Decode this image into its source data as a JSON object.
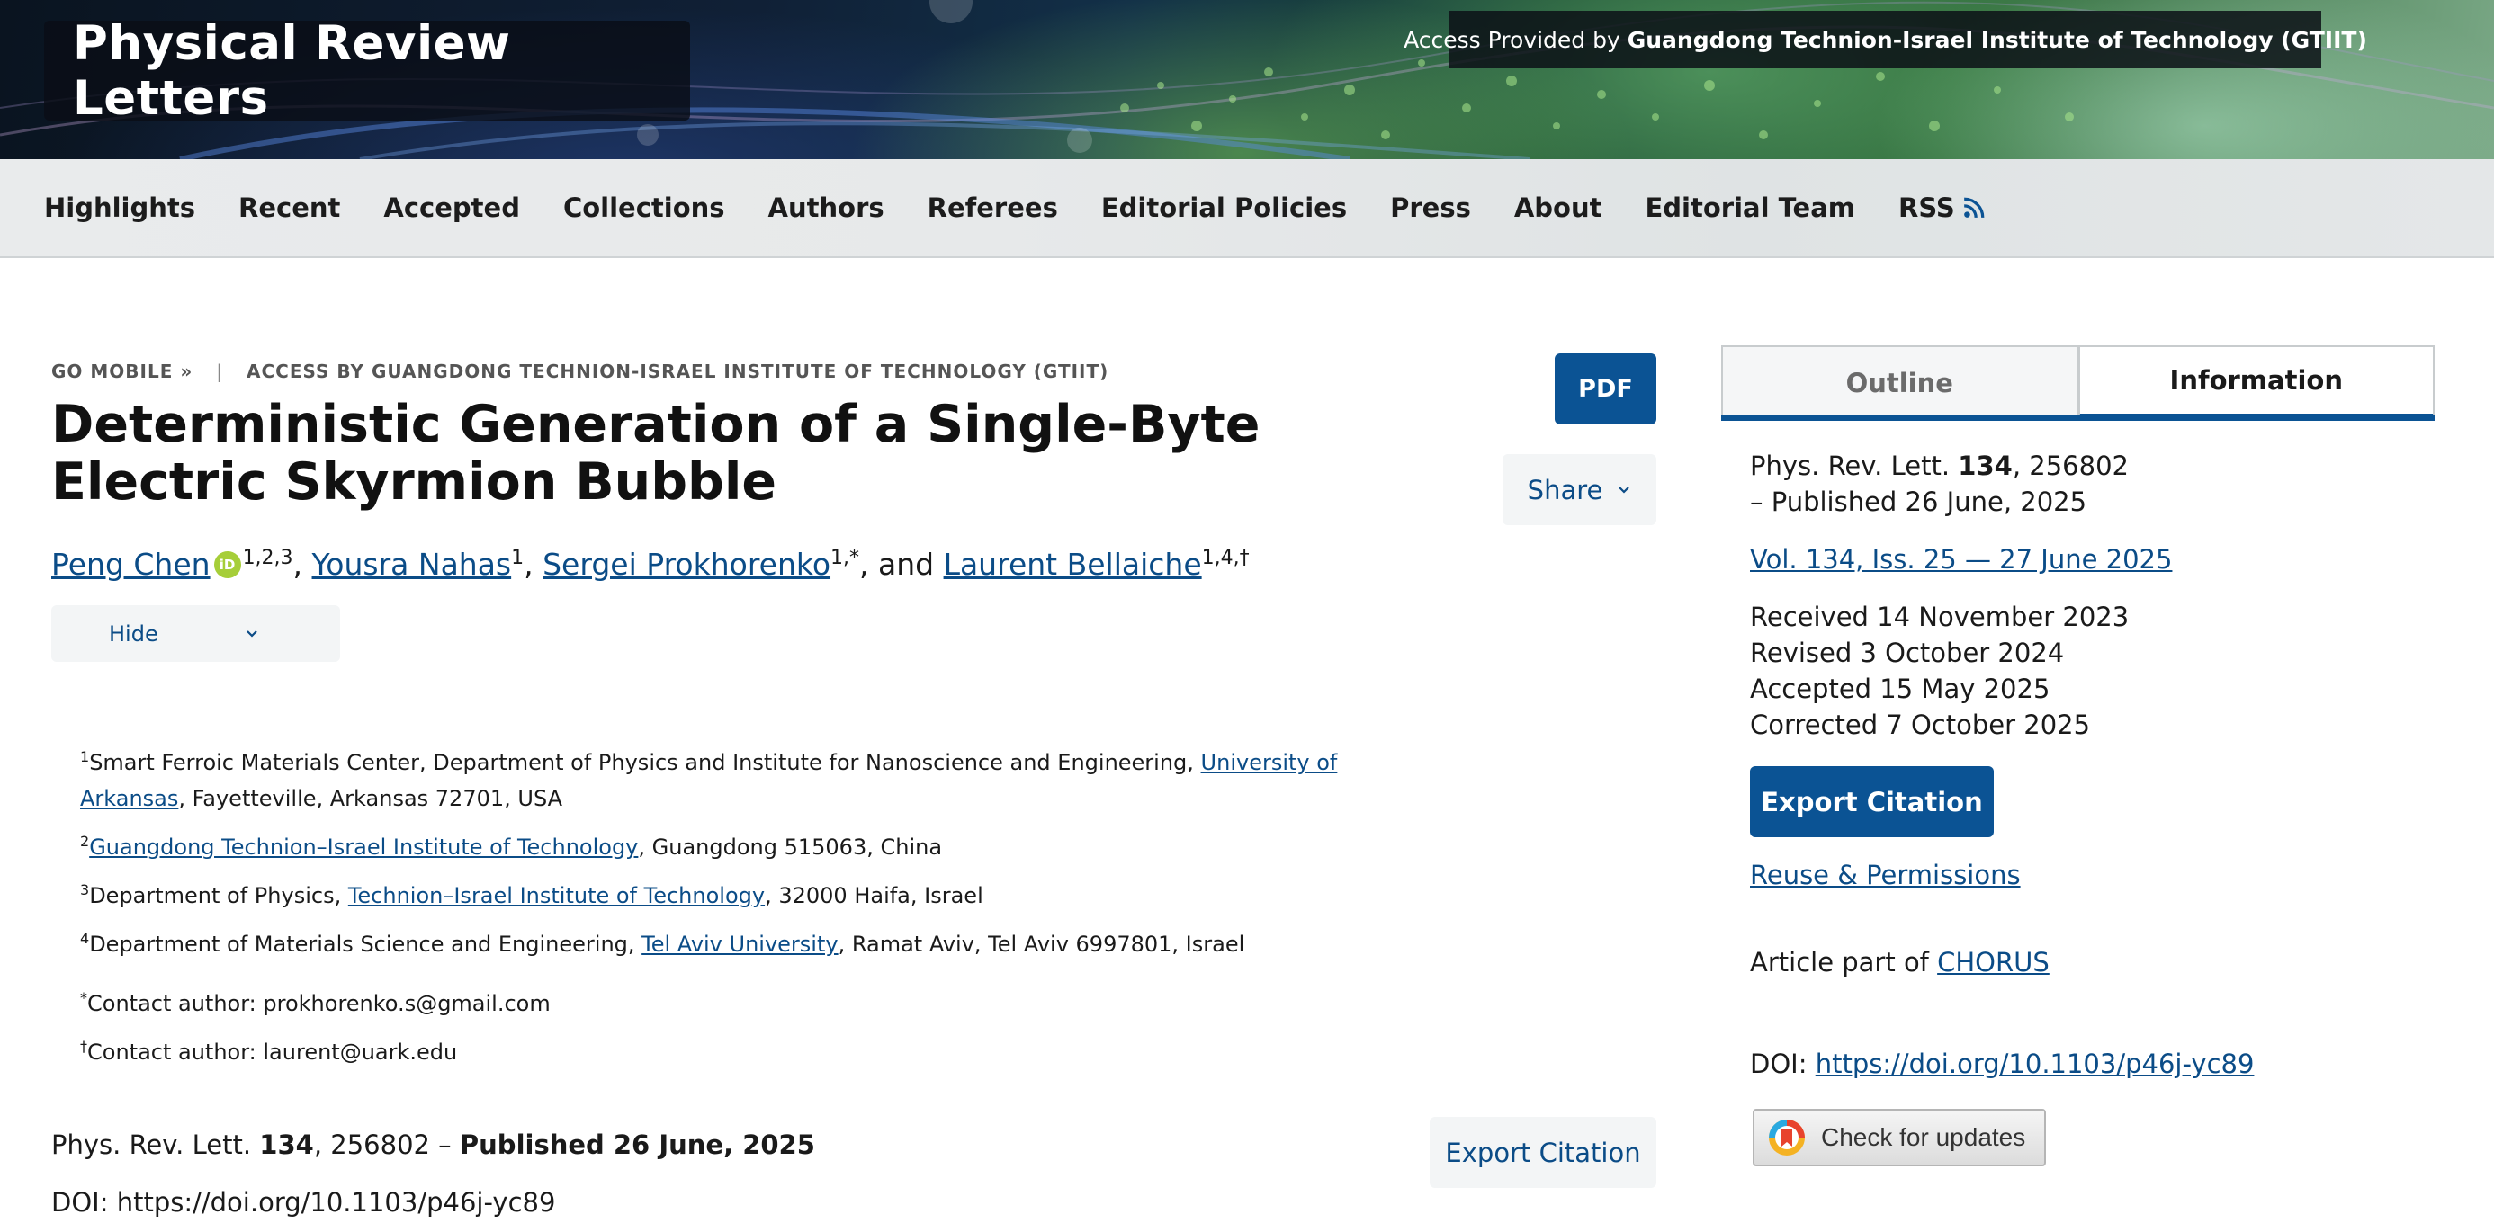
{
  "header": {
    "journal_title": "Physical Review Letters",
    "access_prefix": "Access Provided by ",
    "access_institution": "Guangdong Technion-Israel Institute of Technology (GTIIT)"
  },
  "nav": {
    "items": [
      "Highlights",
      "Recent",
      "Accepted",
      "Collections",
      "Authors",
      "Referees",
      "Editorial Policies",
      "Press",
      "About",
      "Editorial Team",
      "RSS"
    ]
  },
  "top_links": {
    "go_mobile": "GO MOBILE »",
    "separator": "|",
    "access_by": "ACCESS BY GUANGDONG TECHNION-ISRAEL INSTITUTE OF TECHNOLOGY (GTIIT)"
  },
  "article": {
    "title": "Deterministic Generation of a Single-Byte Electric Skyrmion Bubble",
    "pdf_label": "PDF",
    "share_label": "Share",
    "hide_label": "Hide",
    "authors": [
      {
        "name": "Peng Chen",
        "sup": "1,2,3"
      },
      {
        "name": "Yousra Nahas",
        "sup": "1"
      },
      {
        "name": "Sergei Prokhorenko",
        "sup": "1,*"
      },
      {
        "name": "Laurent Bellaiche",
        "sup": "1,4,†"
      }
    ],
    "author_sep_comma": ", ",
    "author_sep_and": ", and ",
    "orcid_label": "iD",
    "affiliations": [
      {
        "sup": "1",
        "pre": "Smart Ferroic Materials Center, Department of Physics and Institute for Nanoscience and Engineering, ",
        "link": "University of Arkansas",
        "post": ", Fayetteville, Arkansas 72701, USA"
      },
      {
        "sup": "2",
        "pre": "",
        "link": "Guangdong Technion–Israel Institute of Technology",
        "post": ", Guangdong 515063, China"
      },
      {
        "sup": "3",
        "pre": "Department of Physics, ",
        "link": "Technion–Israel Institute of Technology",
        "post": ", 32000 Haifa, Israel"
      },
      {
        "sup": "4",
        "pre": "Department of Materials Science and Engineering, ",
        "link": "Tel Aviv University",
        "post": ", Ramat Aviv, Tel Aviv 6997801, Israel"
      }
    ],
    "contacts": [
      {
        "sup": "*",
        "text": "Contact author: prokhorenko.s@gmail.com"
      },
      {
        "sup": "†",
        "text": "Contact author: laurent@uark.edu"
      }
    ],
    "citation": {
      "journal": "Phys. Rev. Lett. ",
      "volume": "134",
      "article_no": ", 256802 – ",
      "published": "Published 26 June, 2025"
    },
    "doi_text": "DOI: https://doi.org/10.1103/p46j-yc89",
    "export_citation_label": "Export Citation"
  },
  "sidebar": {
    "tabs": [
      "Outline",
      "Information"
    ],
    "journal": "Phys. Rev. Lett. ",
    "volume": "134",
    "article_no": ", 256802",
    "published": "– Published 26 June, 2025",
    "issue_link": "Vol. 134, Iss. 25 — 27 June 2025",
    "dates": [
      "Received 14 November 2023",
      "Revised 3 October 2024",
      "Accepted 15 May 2025",
      "Corrected 7 October 2025"
    ],
    "export_citation_label": "Export Citation",
    "reuse_label": "Reuse & Permissions",
    "chorus_prefix": "Article part of ",
    "chorus_link": "CHORUS",
    "doi_prefix": "DOI: ",
    "doi_link": "https://doi.org/10.1103/p46j-yc89",
    "check_updates_label": "Check for updates"
  },
  "colors": {
    "link": "#0b4c87",
    "primary_button": "#0b5394",
    "orcid": "#a6ce39"
  }
}
